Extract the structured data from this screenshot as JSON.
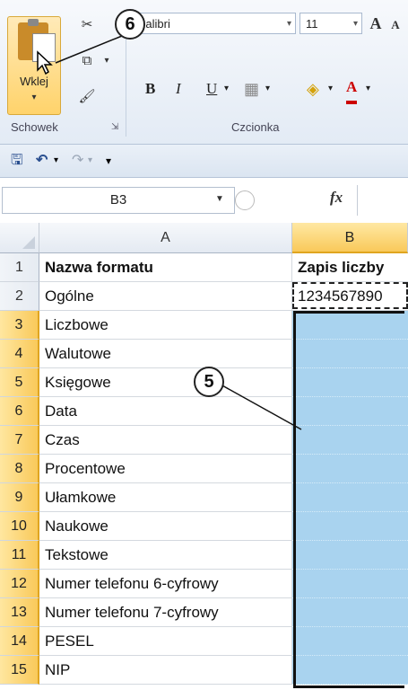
{
  "ribbon": {
    "paste_label": "Wklej",
    "paste_dropdown": "▾",
    "clipboard_group": "Schowek",
    "font_group": "Czcionka",
    "font_name": "Calibri",
    "font_size": "11",
    "bold": "B",
    "italic": "I",
    "underline": "U"
  },
  "formula_bar": {
    "name_box": "B3",
    "fx_label": "fx"
  },
  "columns": [
    "A",
    "B"
  ],
  "rows": [
    {
      "num": "1",
      "a": "Nazwa formatu",
      "b": "Zapis liczby"
    },
    {
      "num": "2",
      "a": "Ogólne",
      "b": "1234567890"
    },
    {
      "num": "3",
      "a": "Liczbowe",
      "b": ""
    },
    {
      "num": "4",
      "a": "Walutowe",
      "b": ""
    },
    {
      "num": "5",
      "a": "Księgowe",
      "b": ""
    },
    {
      "num": "6",
      "a": "Data",
      "b": ""
    },
    {
      "num": "7",
      "a": "Czas",
      "b": ""
    },
    {
      "num": "8",
      "a": "Procentowe",
      "b": ""
    },
    {
      "num": "9",
      "a": "Ułamkowe",
      "b": ""
    },
    {
      "num": "10",
      "a": "Naukowe",
      "b": ""
    },
    {
      "num": "11",
      "a": "Tekstowe",
      "b": ""
    },
    {
      "num": "12",
      "a": "Numer telefonu 6-cyfrowy",
      "b": ""
    },
    {
      "num": "13",
      "a": "Numer telefonu 7-cyfrowy",
      "b": ""
    },
    {
      "num": "14",
      "a": "PESEL",
      "b": ""
    },
    {
      "num": "15",
      "a": "NIP",
      "b": ""
    }
  ],
  "callouts": {
    "paste": "6",
    "range": "5"
  },
  "colors": {
    "selection_fill": "#a9d3ef",
    "header_highlight": "#f9c95a"
  }
}
